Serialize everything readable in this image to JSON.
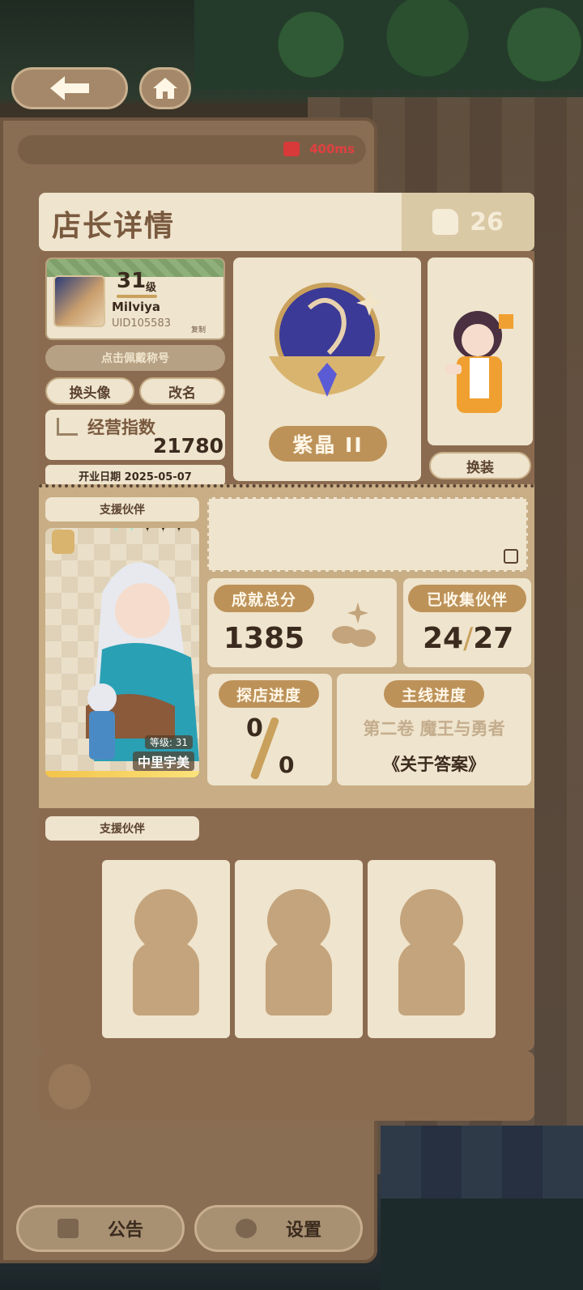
{
  "network": {
    "ping": "400ms"
  },
  "header": {
    "title": "店长详情",
    "likes": "26"
  },
  "profile": {
    "level": "31",
    "level_unit": "级",
    "name": "Milviya",
    "uid": "UID105583",
    "copy": "复制",
    "title_button": "点击佩戴称号",
    "change_avatar": "换头像",
    "rename": "改名",
    "business_index_label": "经营指数",
    "business_index_value": "21780",
    "open_date": "开业日期 2025-05-07"
  },
  "rank": {
    "name": "紫晶 II"
  },
  "outfit_button": "换装",
  "support": {
    "label": "支援伙伴",
    "partner": {
      "level": "等级: 31",
      "name": "中里宇美",
      "stars_lit": 2,
      "stars_total": 5
    }
  },
  "stats": {
    "achievement_label": "成就总分",
    "achievement_value": "1385",
    "collected_label": "已收集伙伴",
    "collected_value": "24",
    "collected_total": "27",
    "visit_label": "探店进度",
    "visit_done": "0",
    "visit_total": "0",
    "main_label": "主线进度",
    "main_chapter": "第二卷 魔王与勇者",
    "main_quest": "《关于答案》"
  },
  "support_slots": {
    "label": "支援伙伴",
    "slots": 3
  },
  "bottom": {
    "notice": "公告",
    "settings": "设置"
  },
  "colors": {
    "accent": "#bd9259",
    "panel": "#efe4cd",
    "frame": "#8b6b50",
    "ping": "#e04040"
  }
}
